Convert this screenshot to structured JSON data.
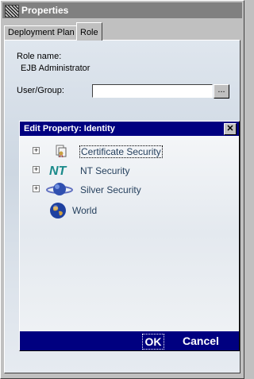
{
  "window": {
    "title": "Properties"
  },
  "tabs": [
    {
      "label": "Deployment Plan",
      "active": false
    },
    {
      "label": "Role",
      "active": true
    }
  ],
  "role": {
    "name_label": "Role name:",
    "name_value": "EJB Administrator",
    "user_group_label": "User/Group:",
    "user_group_value": "",
    "browse_label": "..."
  },
  "dialog": {
    "title": "Edit Property: Identity",
    "close_glyph": "✕",
    "tree": [
      {
        "label": "Certificate Security",
        "icon": "certificate-icon",
        "expandable": true,
        "selected": true
      },
      {
        "label": "NT Security",
        "icon": "nt-icon",
        "expandable": true,
        "selected": false
      },
      {
        "label": "Silver Security",
        "icon": "planet-icon",
        "expandable": true,
        "selected": false
      },
      {
        "label": "World",
        "icon": "globe-icon",
        "expandable": false,
        "selected": false
      }
    ],
    "ok_label": "OK",
    "cancel_label": "Cancel"
  },
  "colors": {
    "titlebar_active": "#000080",
    "titlebar_inactive": "#808080",
    "face": "#c0c0c0"
  }
}
